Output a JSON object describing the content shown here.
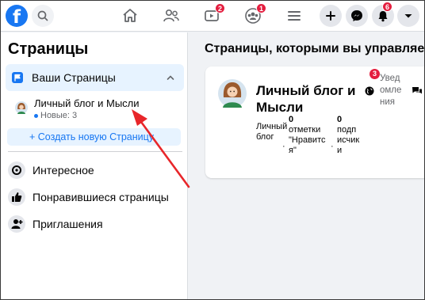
{
  "topbar": {
    "logo": "f",
    "icons": [
      "search-icon",
      "home-icon",
      "friends-icon",
      "watch-icon",
      "groups-icon",
      "menu-icon",
      "create-icon",
      "messenger-icon",
      "notifications-icon",
      "account-icon"
    ],
    "watch_badge": "2",
    "groups_badge": "1",
    "notifications_badge": "6"
  },
  "sidebar": {
    "title": "Страницы",
    "your_pages": "Ваши Страницы",
    "page": {
      "name": "Личный блог и Мысли",
      "new": "Новые: 3"
    },
    "create": "+ Создать новую Страницу",
    "items": [
      {
        "label": "Интересное",
        "icon": "explore-icon"
      },
      {
        "label": "Понравившиеся страницы",
        "icon": "thumbs-up-icon"
      },
      {
        "label": "Приглашения",
        "icon": "invite-icon"
      }
    ]
  },
  "main": {
    "title": "Страницы, которыми вы управляете",
    "card": {
      "name_line1": "Личный блог и",
      "name_line2": "Мысли",
      "category": [
        "Личный",
        "блог"
      ],
      "likes_num": "0",
      "likes_label": [
        "отметки",
        "\"Нравитс",
        "я\""
      ],
      "followers_num": "0",
      "followers_label": [
        "подп",
        "исчик",
        "и"
      ],
      "notif_badge": "3",
      "notif_label": [
        "Увед",
        "омле",
        "ния"
      ]
    }
  },
  "colors": {
    "brand": "#1877f2",
    "badge": "#e41e3f",
    "arrow": "#e8262a"
  }
}
